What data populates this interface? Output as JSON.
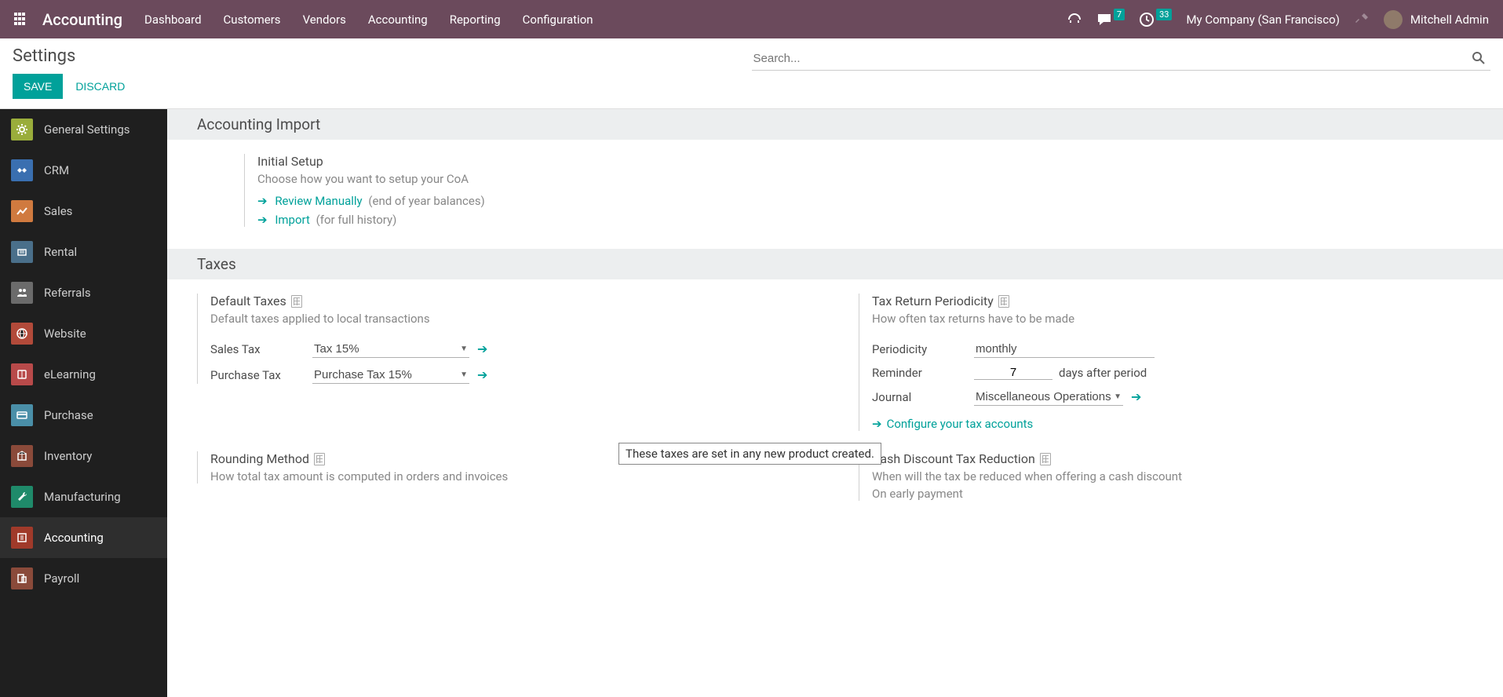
{
  "topbar": {
    "brand": "Accounting",
    "menu": [
      "Dashboard",
      "Customers",
      "Vendors",
      "Accounting",
      "Reporting",
      "Configuration"
    ],
    "messages_badge": "7",
    "activities_badge": "33",
    "company": "My Company (San Francisco)",
    "user": "Mitchell Admin"
  },
  "control": {
    "title": "Settings",
    "save": "SAVE",
    "discard": "DISCARD",
    "search_placeholder": "Search..."
  },
  "sidebar": {
    "items": [
      {
        "label": "General Settings",
        "color": "#9aad3b"
      },
      {
        "label": "CRM",
        "color": "#3a6fb0"
      },
      {
        "label": "Sales",
        "color": "#d07a3f"
      },
      {
        "label": "Rental",
        "color": "#4a6f8a"
      },
      {
        "label": "Referrals",
        "color": "#6b6b6b"
      },
      {
        "label": "Website",
        "color": "#b24a3a"
      },
      {
        "label": "eLearning",
        "color": "#b84a4a"
      },
      {
        "label": "Purchase",
        "color": "#4a8fa8"
      },
      {
        "label": "Inventory",
        "color": "#8a4a3a"
      },
      {
        "label": "Manufacturing",
        "color": "#1f8a6a"
      },
      {
        "label": "Accounting",
        "color": "#a03a2a",
        "active": true
      },
      {
        "label": "Payroll",
        "color": "#8a4a3a"
      }
    ]
  },
  "sections": {
    "accounting_import": {
      "header": "Accounting Import",
      "title": "Initial Setup",
      "desc": "Choose how you want to setup your CoA",
      "link1": "Review Manually",
      "link1_suffix": "(end of year balances)",
      "link2": "Import",
      "link2_suffix": "(for full history)"
    },
    "taxes": {
      "header": "Taxes",
      "default_taxes": {
        "title": "Default Taxes",
        "desc": "Default taxes applied to local transactions",
        "sales_label": "Sales Tax",
        "sales_value": "Tax 15%",
        "purchase_label": "Purchase Tax",
        "purchase_value": "Purchase Tax 15%"
      },
      "periodicity": {
        "title": "Tax Return Periodicity",
        "desc": "How often tax returns have to be made",
        "period_label": "Periodicity",
        "period_value": "monthly",
        "reminder_label": "Reminder",
        "reminder_value": "7",
        "reminder_after": "days after period",
        "journal_label": "Journal",
        "journal_value": "Miscellaneous Operations",
        "configure_link": "Configure your tax accounts"
      },
      "rounding": {
        "title": "Rounding Method",
        "desc": "How total tax amount is computed in orders and invoices"
      },
      "cash_discount": {
        "title": "Cash Discount Tax Reduction",
        "desc": "When will the tax be reduced when offering a cash discount",
        "sub": "On early payment"
      }
    }
  },
  "tooltip": "These taxes are set in any new product created."
}
